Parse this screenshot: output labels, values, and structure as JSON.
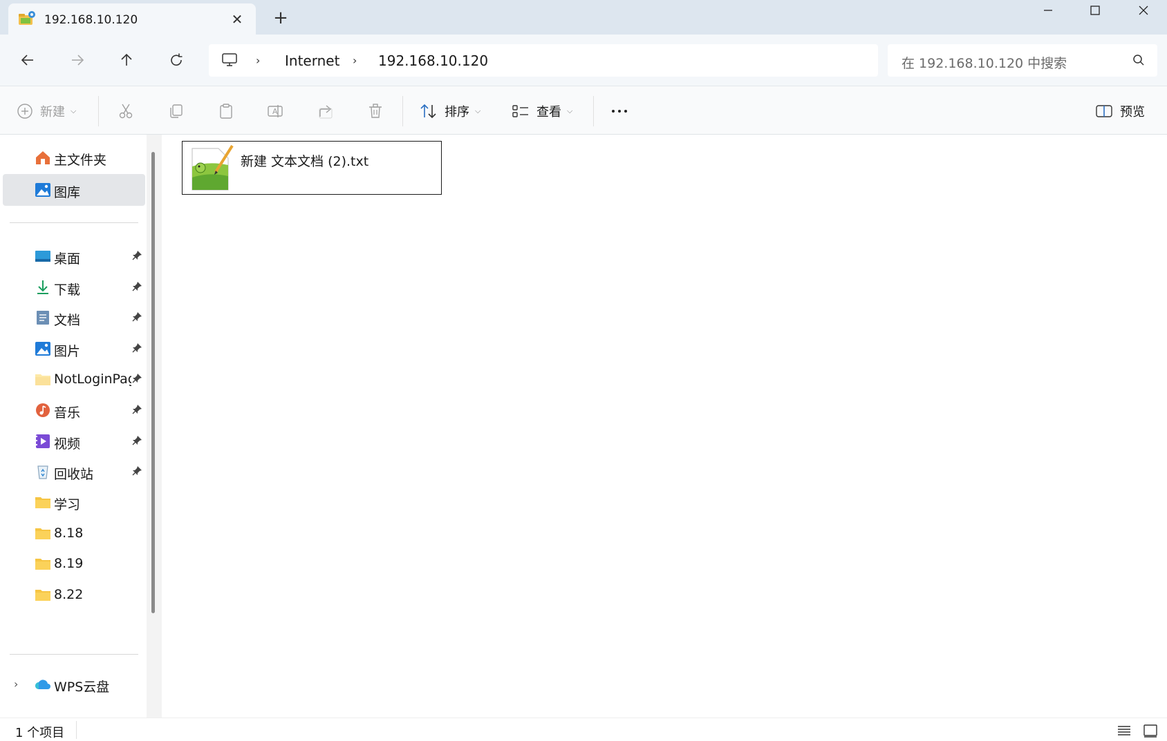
{
  "tab": {
    "title": "192.168.10.120",
    "icon": "network-folder-icon"
  },
  "window": {
    "minimize": "minimize-icon",
    "maximize": "maximize-icon",
    "close": "close-icon"
  },
  "nav": {
    "back": "arrow-left-icon",
    "forward": "arrow-right-icon",
    "up": "arrow-up-icon",
    "refresh": "refresh-icon",
    "breadcrumb": [
      "Internet",
      "192.168.10.120"
    ],
    "search_placeholder": "在 192.168.10.120 中搜索"
  },
  "commands": {
    "new_label": "新建",
    "sort_label": "排序",
    "view_label": "查看",
    "preview_label": "预览"
  },
  "sidebar": {
    "top": [
      {
        "label": "主文件夹",
        "icon": "home-icon"
      },
      {
        "label": "图库",
        "icon": "gallery-icon"
      }
    ],
    "pinned": [
      {
        "label": "桌面",
        "icon": "desktop-icon"
      },
      {
        "label": "下载",
        "icon": "download-icon"
      },
      {
        "label": "文档",
        "icon": "document-icon"
      },
      {
        "label": "图片",
        "icon": "pictures-icon"
      },
      {
        "label": "NotLoginPage",
        "icon": "folder-icon"
      },
      {
        "label": "音乐",
        "icon": "music-icon"
      },
      {
        "label": "视频",
        "icon": "video-icon"
      },
      {
        "label": "回收站",
        "icon": "recycle-bin-icon"
      },
      {
        "label": "学习",
        "icon": "folder-icon"
      },
      {
        "label": "8.18",
        "icon": "folder-icon"
      },
      {
        "label": "8.19",
        "icon": "folder-icon"
      },
      {
        "label": "8.22",
        "icon": "folder-icon"
      }
    ],
    "drives": [
      {
        "label": "WPS云盘",
        "icon": "cloud-icon"
      }
    ]
  },
  "files": [
    {
      "name": "新建 文本文档 (2).txt",
      "icon": "notepad-plus-plus-file-icon"
    }
  ],
  "status": {
    "item_count": "1 个项目"
  },
  "colors": {
    "titlebar": "#dde6ef",
    "navbar": "#f4f7fa",
    "selected": "#e4e6e9"
  }
}
